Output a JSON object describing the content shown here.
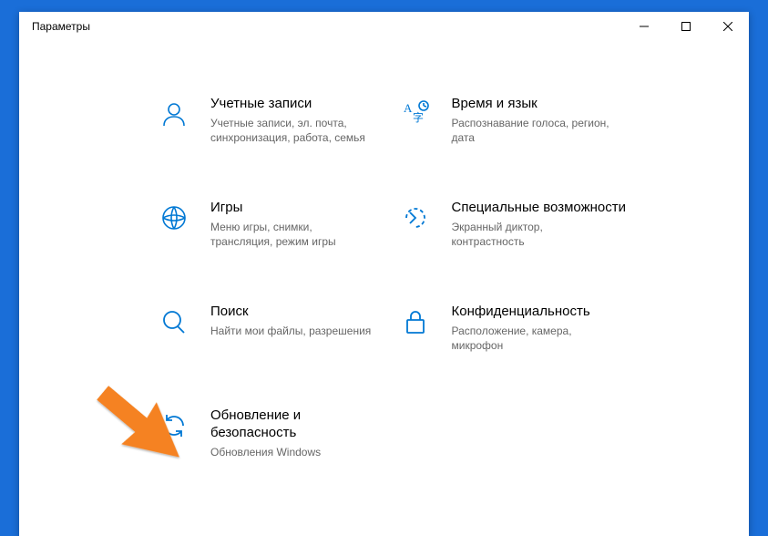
{
  "window": {
    "title": "Параметры"
  },
  "accent_color": "#0078d4",
  "arrow_color": "#f58220",
  "items": {
    "accounts": {
      "title": "Учетные записи",
      "desc": "Учетные записи, эл. почта, синхронизация, работа, семья"
    },
    "time": {
      "title": "Время и язык",
      "desc": "Распознавание голоса, регион, дата"
    },
    "gaming": {
      "title": "Игры",
      "desc": "Меню игры, снимки, трансляция, режим игры"
    },
    "ease": {
      "title": "Специальные возможности",
      "desc": "Экранный диктор, контрастность"
    },
    "search": {
      "title": "Поиск",
      "desc": "Найти мои файлы, разрешения"
    },
    "privacy": {
      "title": "Конфиденциальность",
      "desc": "Расположение, камера, микрофон"
    },
    "update": {
      "title": "Обновление и безопасность",
      "desc": "Обновления Windows"
    }
  }
}
